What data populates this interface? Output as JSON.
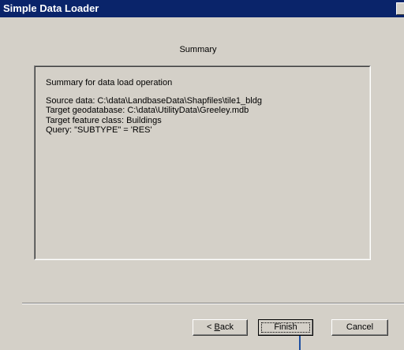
{
  "window": {
    "title": "Simple Data Loader"
  },
  "page": {
    "heading": "Summary"
  },
  "summary": {
    "header": "Summary for data load operation",
    "lines": [
      "Source data: C:\\data\\LandbaseData\\Shapfiles\\tile1_bldg",
      "Target geodatabase: C:\\data\\UtilityData\\Greeley.mdb",
      "Target feature class: Buildings",
      "Query: \"SUBTYPE\" = 'RES'"
    ]
  },
  "buttons": {
    "back_prefix": "< ",
    "back_mnemonic": "B",
    "back_rest": "ack",
    "finish": "Finish",
    "cancel": "Cancel"
  },
  "colors": {
    "titlebar": "#0a246a",
    "dialog_face": "#d4d0c8",
    "callout_line": "#1e4fa0"
  }
}
